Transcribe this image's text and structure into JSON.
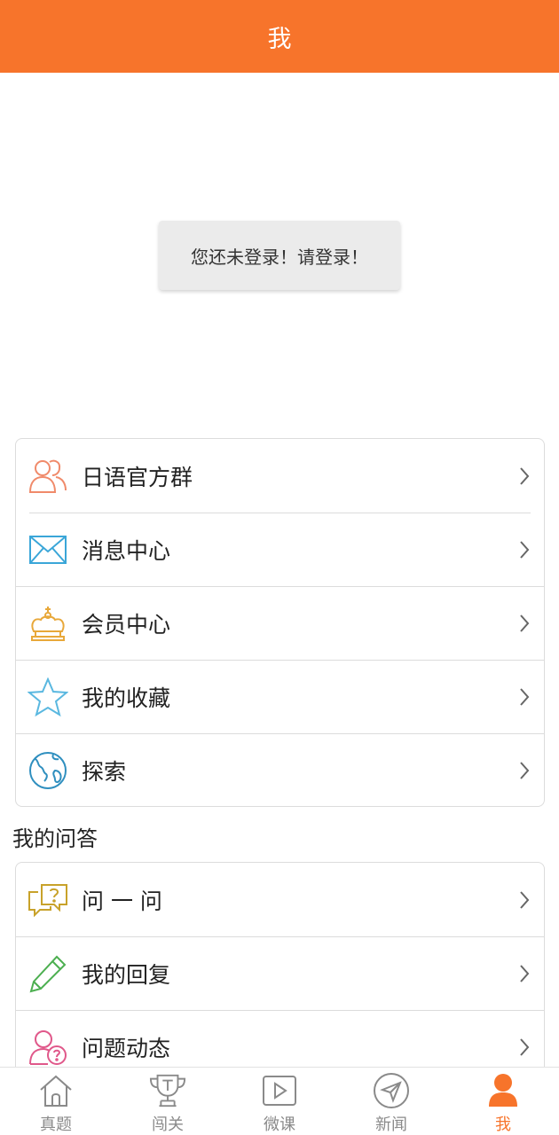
{
  "header": {
    "title": "我"
  },
  "login_prompt": "您还未登录！请登录！",
  "menu": [
    {
      "label": "日语官方群",
      "icon": "users-icon"
    },
    {
      "label": "消息中心",
      "icon": "mail-icon"
    },
    {
      "label": "会员中心",
      "icon": "crown-icon"
    },
    {
      "label": "我的收藏",
      "icon": "star-icon"
    },
    {
      "label": "探索",
      "icon": "globe-icon"
    }
  ],
  "qa_section": {
    "title": "我的问答",
    "items": [
      {
        "label": "问 一 问",
        "icon": "question-chat-icon"
      },
      {
        "label": "我的回复",
        "icon": "pencil-icon"
      },
      {
        "label": "问题动态",
        "icon": "user-question-icon"
      }
    ]
  },
  "tabbar": [
    {
      "label": "真题",
      "icon": "home-icon",
      "active": false
    },
    {
      "label": "闯关",
      "icon": "trophy-icon",
      "active": false
    },
    {
      "label": "微课",
      "icon": "play-icon",
      "active": false
    },
    {
      "label": "新闻",
      "icon": "send-icon",
      "active": false
    },
    {
      "label": "我",
      "icon": "profile-icon",
      "active": true
    }
  ],
  "colors": {
    "accent": "#f7742b",
    "users_icon": "#f08a6a",
    "mail_icon": "#3aa6d8",
    "crown_icon": "#e8a83a",
    "star_icon": "#5ab8e0",
    "globe_icon": "#2f8fbf",
    "question_icon": "#c8a22a",
    "pencil_icon": "#4caf50",
    "user_question_icon": "#e0588a",
    "tab_inactive": "#8a8a8a"
  }
}
